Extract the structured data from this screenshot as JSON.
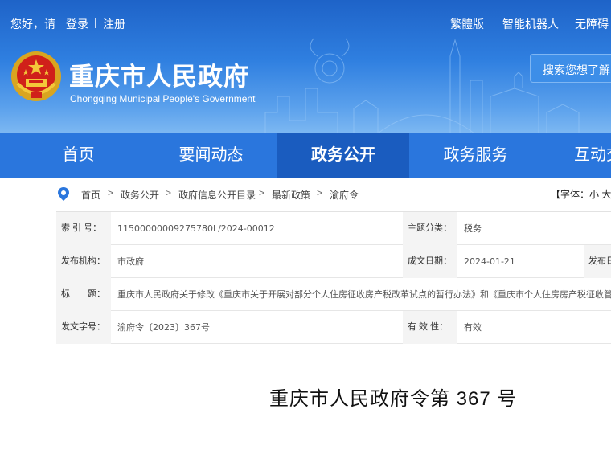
{
  "topbar": {
    "greeting": "您好，请",
    "login": "登录",
    "separator": "|",
    "register": "注册",
    "traditional": "繁體版",
    "robot": "智能机器人",
    "accessibility": "无障碍"
  },
  "header": {
    "title": "重庆市人民政府",
    "subtitle": "Chongqing Municipal People's Government",
    "search_placeholder": "搜索您想了解的"
  },
  "nav": {
    "items": [
      {
        "label": "首页"
      },
      {
        "label": "要闻动态"
      },
      {
        "label": "政务公开"
      },
      {
        "label": "政务服务"
      },
      {
        "label": "互动交流"
      }
    ]
  },
  "breadcrumb": {
    "items": [
      "首页",
      "政务公开",
      "政府信息公开目录",
      "最新政策",
      "渝府令"
    ],
    "arrow": ">",
    "font_label": "【字体：小 大】"
  },
  "info": {
    "index_label": "索 引 号：",
    "index_value": "11500000009275780L/2024-00012",
    "category_label": "主题分类：",
    "category_value": "税务",
    "issuer_label": "发布机构：",
    "issuer_value": "市政府",
    "date_label": "成文日期：",
    "date_value": "2024-01-21",
    "publish_label": "发布日期：",
    "title_label": "标　　题：",
    "title_value": "重庆市人民政府关于修改《重庆市关于开展对部分个人住房征收房产税改革试点的暂行办法》和《重庆市个人住房房产税征收管理实施细则》的决定",
    "docno_label": "发文字号：",
    "docno_value": "渝府令〔2023〕367号",
    "valid_label": "有 效 性：",
    "valid_value": "有效"
  },
  "document": {
    "title": "重庆市人民政府令第  367  号"
  },
  "colors": {
    "header_blue": "#2f7fe0",
    "nav_blue": "#2a76dd",
    "nav_active": "#1a5cbf"
  }
}
